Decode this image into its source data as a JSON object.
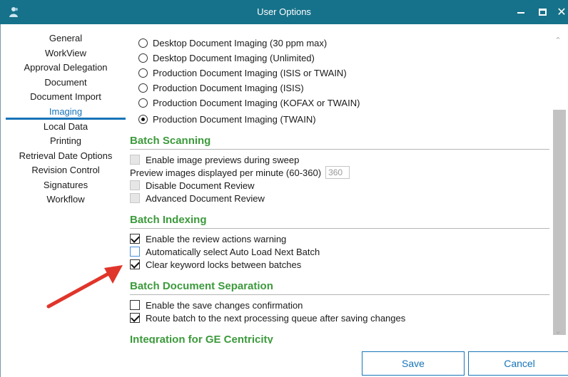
{
  "window": {
    "title": "User Options",
    "minimize_icon": "minimize-icon",
    "maximize_icon": "maximize-icon",
    "close_glyph": "✕"
  },
  "sidebar": {
    "items": [
      {
        "label": "General",
        "active": false
      },
      {
        "label": "WorkView",
        "active": false
      },
      {
        "label": "Approval Delegation",
        "active": false
      },
      {
        "label": "Document",
        "active": false
      },
      {
        "label": "Document Import",
        "active": false
      },
      {
        "label": "Imaging",
        "active": true
      },
      {
        "label": "Local Data",
        "active": false
      },
      {
        "label": "Printing",
        "active": false
      },
      {
        "label": "Retrieval Date Options",
        "active": false
      },
      {
        "label": "Revision Control",
        "active": false
      },
      {
        "label": "Signatures",
        "active": false
      },
      {
        "label": "Workflow",
        "active": false
      }
    ]
  },
  "imaging": {
    "radios": [
      {
        "label": "Desktop Document Imaging (30 ppm max)",
        "checked": false
      },
      {
        "label": "Desktop Document Imaging (Unlimited)",
        "checked": false
      },
      {
        "label": "Production Document Imaging (ISIS or TWAIN)",
        "checked": false
      },
      {
        "label": "Production Document Imaging (ISIS)",
        "checked": false
      },
      {
        "label": "Production Document Imaging (KOFAX or TWAIN)",
        "checked": false
      },
      {
        "label": "Production Document Imaging (TWAIN)",
        "checked": true
      }
    ]
  },
  "batch_scanning": {
    "heading": "Batch Scanning",
    "enable_previews": {
      "label": "Enable image previews during sweep",
      "checked": false,
      "disabled": true
    },
    "ppm_label": "Preview images displayed per minute (60-360)",
    "ppm_value": "360",
    "disable_review": {
      "label": "Disable Document Review",
      "checked": false,
      "disabled": true
    },
    "advanced_review": {
      "label": "Advanced Document Review",
      "checked": false,
      "disabled": true
    }
  },
  "batch_indexing": {
    "heading": "Batch Indexing",
    "review_warning": {
      "label": "Enable the review actions warning",
      "checked": true
    },
    "auto_load": {
      "label": "Automatically select Auto Load Next Batch",
      "checked": false
    },
    "clear_locks": {
      "label": "Clear keyword locks between batches",
      "checked": true
    }
  },
  "batch_separation": {
    "heading": "Batch Document Separation",
    "save_confirm": {
      "label": "Enable the save changes confirmation",
      "checked": false
    },
    "route_batch": {
      "label": "Route batch to the next processing queue after saving changes",
      "checked": true
    }
  },
  "integration": {
    "heading": "Integration for GE Centricity"
  },
  "buttons": {
    "save": "Save",
    "cancel": "Cancel"
  },
  "colors": {
    "titlebar": "#16728a",
    "accent": "#1774b8",
    "section_heading": "#3c9a3c",
    "annotation_arrow": "#e0352b"
  }
}
